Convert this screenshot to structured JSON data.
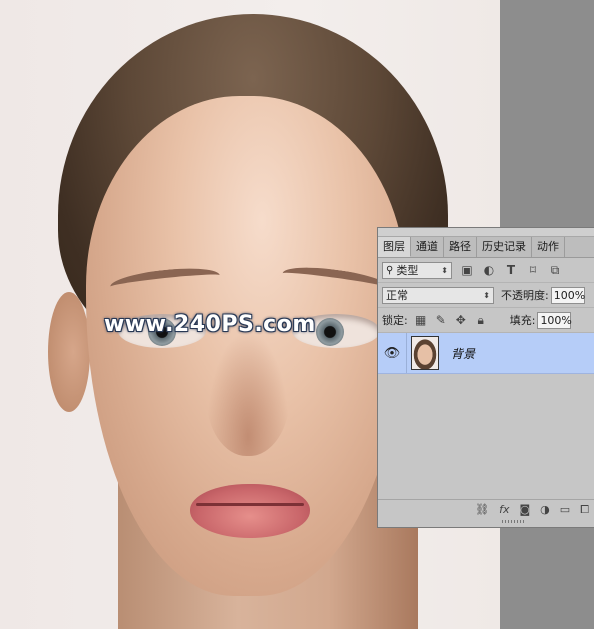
{
  "watermark": "www.240PS.com",
  "layers_panel": {
    "tabs": [
      "图层",
      "通道",
      "路径",
      "历史记录",
      "动作"
    ],
    "filter": {
      "icon": "search-icon",
      "value": "类型"
    },
    "filter_icons": [
      "image-filter-icon",
      "adjustment-filter-icon",
      "text-filter-icon",
      "shape-filter-icon",
      "smart-object-filter-icon"
    ],
    "blend_mode": "正常",
    "opacity_label": "不透明度:",
    "opacity_value": "100%",
    "lock_label": "锁定:",
    "lock_icons": [
      "lock-transparent-icon",
      "lock-brush-icon",
      "lock-move-icon",
      "lock-all-icon"
    ],
    "fill_label": "填充:",
    "fill_value": "100%",
    "layers": [
      {
        "name": "背景",
        "visible": true,
        "selected": true
      }
    ],
    "footer_icons": [
      "link-icon",
      "fx-icon",
      "mask-icon",
      "adjustment-icon",
      "folder-icon",
      "new-layer-icon"
    ],
    "fx_label": "fx"
  },
  "colors": {
    "selected_layer": "#b6cdf8",
    "panel_bg": "#c6c6c6",
    "outer_bg": "#8f8f8f"
  }
}
